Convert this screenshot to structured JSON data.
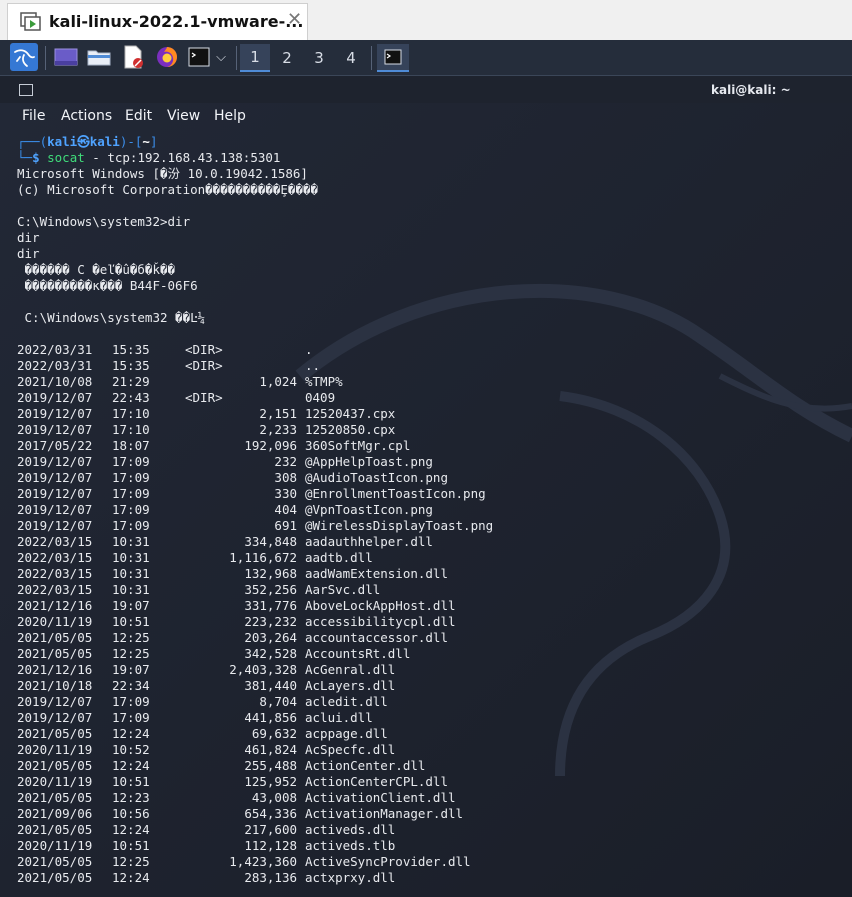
{
  "vm_tab": {
    "title": "kali-linux-2022.1-vmware-...",
    "close_glyph": "✕"
  },
  "panel": {
    "workspaces": [
      "1",
      "2",
      "3",
      "4"
    ],
    "active_workspace": "1",
    "launcher_dropdown": "⌵"
  },
  "terminal": {
    "window_title": "kali@kali: ~",
    "menu": [
      "File",
      "Actions",
      "Edit",
      "View",
      "Help"
    ],
    "prompt": {
      "top_left": "┌──(",
      "user": "kali",
      "at": "㉿",
      "host": "kali",
      "mid": ")-[",
      "path": "~",
      "end": "]",
      "bottom": "└─",
      "symbol": "$",
      "command": "socat",
      "args": " - tcp:192.168.43.138:5301"
    },
    "header_lines": [
      "Microsoft Windows [�汾 10.0.19042.1586]",
      "(c) Microsoft Corporation����������Ȩ����",
      "",
      "C:\\Windows\\system32>dir",
      "dir",
      "dir",
      " ������ C �еľ�û�б�ǩ��",
      " ���������к��� B44F-06F6",
      "",
      " C:\\Windows\\system32 ��Ŀ¼",
      ""
    ],
    "listing": [
      {
        "date": "2022/03/31",
        "time": "15:35",
        "dir": "<DIR>",
        "size": "",
        "name": "."
      },
      {
        "date": "2022/03/31",
        "time": "15:35",
        "dir": "<DIR>",
        "size": "",
        "name": ".."
      },
      {
        "date": "2021/10/08",
        "time": "21:29",
        "dir": "",
        "size": "1,024",
        "name": "%TMP%"
      },
      {
        "date": "2019/12/07",
        "time": "22:43",
        "dir": "<DIR>",
        "size": "",
        "name": "0409"
      },
      {
        "date": "2019/12/07",
        "time": "17:10",
        "dir": "",
        "size": "2,151",
        "name": "12520437.cpx"
      },
      {
        "date": "2019/12/07",
        "time": "17:10",
        "dir": "",
        "size": "2,233",
        "name": "12520850.cpx"
      },
      {
        "date": "2017/05/22",
        "time": "18:07",
        "dir": "",
        "size": "192,096",
        "name": "360SoftMgr.cpl"
      },
      {
        "date": "2019/12/07",
        "time": "17:09",
        "dir": "",
        "size": "232",
        "name": "@AppHelpToast.png"
      },
      {
        "date": "2019/12/07",
        "time": "17:09",
        "dir": "",
        "size": "308",
        "name": "@AudioToastIcon.png"
      },
      {
        "date": "2019/12/07",
        "time": "17:09",
        "dir": "",
        "size": "330",
        "name": "@EnrollmentToastIcon.png"
      },
      {
        "date": "2019/12/07",
        "time": "17:09",
        "dir": "",
        "size": "404",
        "name": "@VpnToastIcon.png"
      },
      {
        "date": "2019/12/07",
        "time": "17:09",
        "dir": "",
        "size": "691",
        "name": "@WirelessDisplayToast.png"
      },
      {
        "date": "2022/03/15",
        "time": "10:31",
        "dir": "",
        "size": "334,848",
        "name": "aadauthhelper.dll"
      },
      {
        "date": "2022/03/15",
        "time": "10:31",
        "dir": "",
        "size": "1,116,672",
        "name": "aadtb.dll"
      },
      {
        "date": "2022/03/15",
        "time": "10:31",
        "dir": "",
        "size": "132,968",
        "name": "aadWamExtension.dll"
      },
      {
        "date": "2022/03/15",
        "time": "10:31",
        "dir": "",
        "size": "352,256",
        "name": "AarSvc.dll"
      },
      {
        "date": "2021/12/16",
        "time": "19:07",
        "dir": "",
        "size": "331,776",
        "name": "AboveLockAppHost.dll"
      },
      {
        "date": "2020/11/19",
        "time": "10:51",
        "dir": "",
        "size": "223,232",
        "name": "accessibilitycpl.dll"
      },
      {
        "date": "2021/05/05",
        "time": "12:25",
        "dir": "",
        "size": "203,264",
        "name": "accountaccessor.dll"
      },
      {
        "date": "2021/05/05",
        "time": "12:25",
        "dir": "",
        "size": "342,528",
        "name": "AccountsRt.dll"
      },
      {
        "date": "2021/12/16",
        "time": "19:07",
        "dir": "",
        "size": "2,403,328",
        "name": "AcGenral.dll"
      },
      {
        "date": "2021/10/18",
        "time": "22:34",
        "dir": "",
        "size": "381,440",
        "name": "AcLayers.dll"
      },
      {
        "date": "2019/12/07",
        "time": "17:09",
        "dir": "",
        "size": "8,704",
        "name": "acledit.dll"
      },
      {
        "date": "2019/12/07",
        "time": "17:09",
        "dir": "",
        "size": "441,856",
        "name": "aclui.dll"
      },
      {
        "date": "2021/05/05",
        "time": "12:24",
        "dir": "",
        "size": "69,632",
        "name": "acppage.dll"
      },
      {
        "date": "2020/11/19",
        "time": "10:52",
        "dir": "",
        "size": "461,824",
        "name": "AcSpecfc.dll"
      },
      {
        "date": "2021/05/05",
        "time": "12:24",
        "dir": "",
        "size": "255,488",
        "name": "ActionCenter.dll"
      },
      {
        "date": "2020/11/19",
        "time": "10:51",
        "dir": "",
        "size": "125,952",
        "name": "ActionCenterCPL.dll"
      },
      {
        "date": "2021/05/05",
        "time": "12:23",
        "dir": "",
        "size": "43,008",
        "name": "ActivationClient.dll"
      },
      {
        "date": "2021/09/06",
        "time": "10:56",
        "dir": "",
        "size": "654,336",
        "name": "ActivationManager.dll"
      },
      {
        "date": "2021/05/05",
        "time": "12:24",
        "dir": "",
        "size": "217,600",
        "name": "activeds.dll"
      },
      {
        "date": "2020/11/19",
        "time": "10:51",
        "dir": "",
        "size": "112,128",
        "name": "activeds.tlb"
      },
      {
        "date": "2021/05/05",
        "time": "12:25",
        "dir": "",
        "size": "1,423,360",
        "name": "ActiveSyncProvider.dll"
      },
      {
        "date": "2021/05/05",
        "time": "12:24",
        "dir": "",
        "size": "283,136",
        "name": "actxprxy.dll"
      }
    ]
  },
  "colors": {
    "panel_bg": "#252d3b",
    "terminal_bg": "#1f2430",
    "prompt_blue": "#3b8eea",
    "command_green": "#3fdb7a"
  },
  "icons": [
    "vmware-vm-icon",
    "kali-menu-icon",
    "show-desktop-icon",
    "file-manager-icon",
    "text-editor-icon",
    "firefox-icon",
    "terminal-icon",
    "dropdown-chevron-icon",
    "terminal-task-icon",
    "terminal-window-icon"
  ]
}
